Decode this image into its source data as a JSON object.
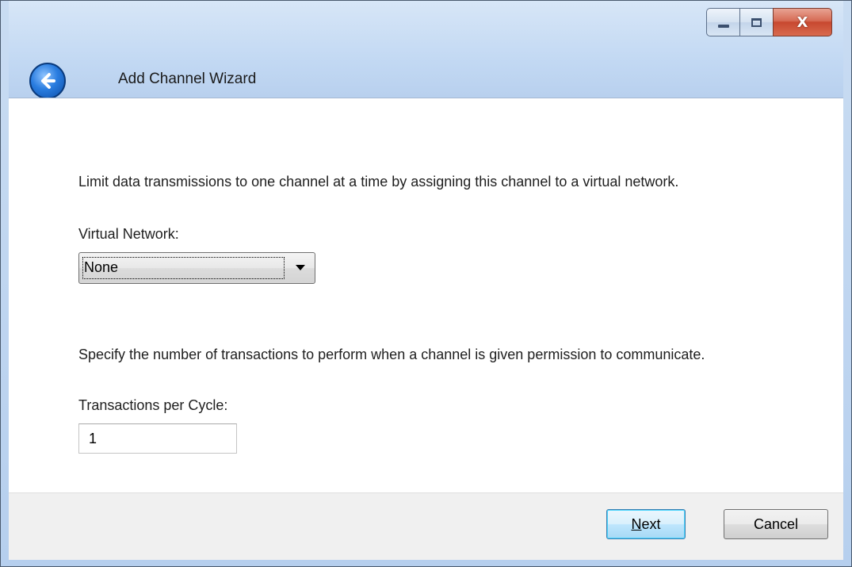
{
  "window": {
    "title": "Add Channel Wizard",
    "controls": {
      "minimize": "minimize",
      "maximize": "maximize",
      "close": "X"
    }
  },
  "content": {
    "virtual_network_description": "Limit data transmissions to one channel at a time by assigning this channel to a virtual network.",
    "virtual_network_label": "Virtual Network:",
    "virtual_network_value": "None",
    "transactions_description": "Specify the number of transactions to perform when a channel is given permission to communicate.",
    "transactions_label": "Transactions per Cycle:",
    "transactions_value": "1"
  },
  "footer": {
    "next_label_accel": "N",
    "next_label_rest": "ext",
    "cancel_label": "Cancel"
  },
  "colors": {
    "title_bar": "#c3d9f3",
    "close_button": "#c7482f",
    "footer_bg": "#f0f0f0",
    "default_button_border": "#3c7fb1"
  },
  "icons": [
    "back-arrow-icon",
    "minimize-icon",
    "maximize-icon",
    "close-icon",
    "dropdown-arrow-icon"
  ]
}
